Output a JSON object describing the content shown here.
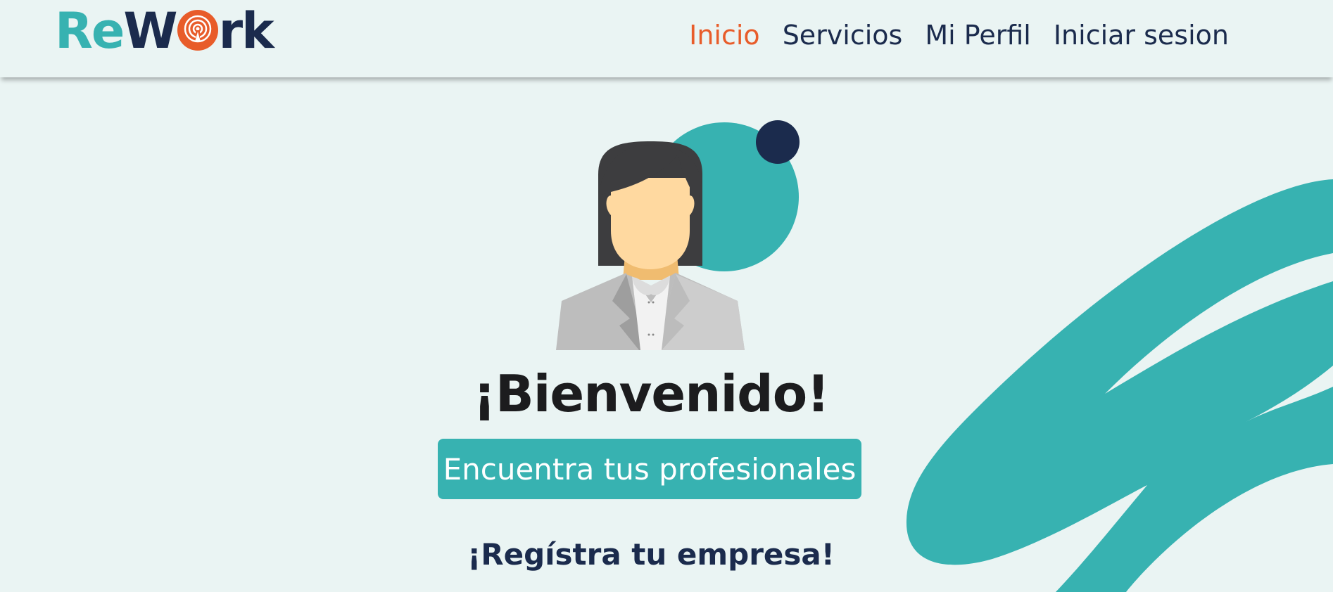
{
  "header": {
    "logo": {
      "part1": "Re",
      "part2": "W",
      "part3": "rk"
    },
    "nav": [
      {
        "label": "Inicio",
        "active": true
      },
      {
        "label": "Servicios",
        "active": false
      },
      {
        "label": "Mi Perfil",
        "active": false
      },
      {
        "label": "Iniciar sesion",
        "active": false
      }
    ]
  },
  "hero": {
    "welcome": "¡Bienvenido!",
    "cta_label": "Encuentra tus profesionales",
    "register_label": "¡Regístra tu empresa!"
  },
  "colors": {
    "background": "#eaf4f3",
    "teal": "#37b2b1",
    "navy": "#1b2b4d",
    "orange": "#e85c2a"
  },
  "icons": {
    "logo_o": "broadcast-icon",
    "illustration": "businesswoman-avatar"
  }
}
